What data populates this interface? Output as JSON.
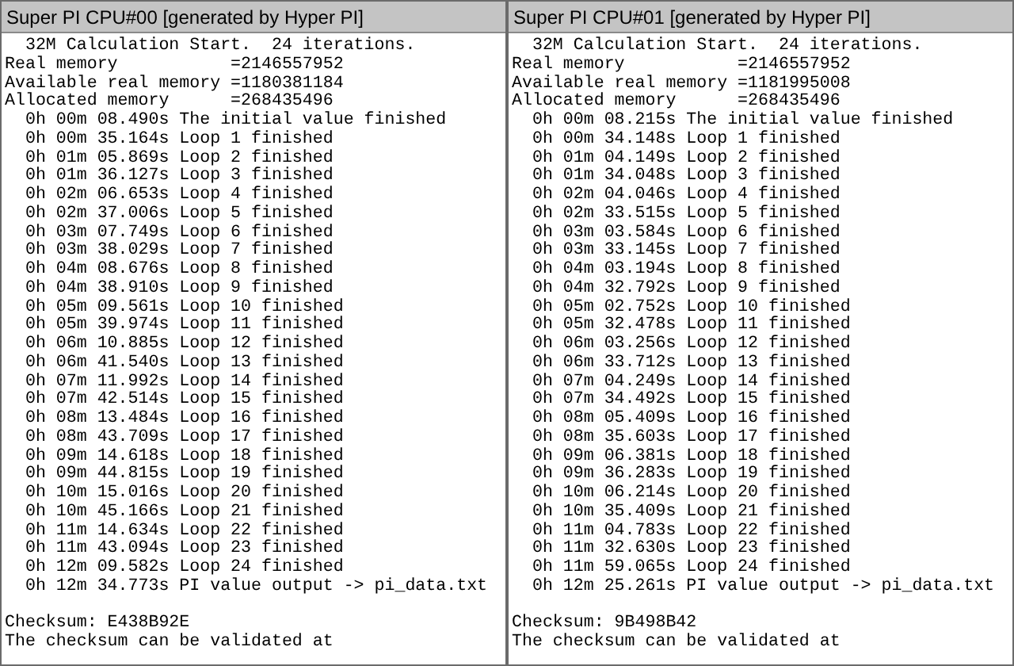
{
  "windows": [
    {
      "title": "Super PI CPU#00 [generated by Hyper PI]",
      "lines": [
        "  32M Calculation Start.  24 iterations.",
        "Real memory           =2146557952",
        "Available real memory =1180381184",
        "Allocated memory      =268435496",
        "  0h 00m 08.490s The initial value finished",
        "  0h 00m 35.164s Loop 1 finished",
        "  0h 01m 05.869s Loop 2 finished",
        "  0h 01m 36.127s Loop 3 finished",
        "  0h 02m 06.653s Loop 4 finished",
        "  0h 02m 37.006s Loop 5 finished",
        "  0h 03m 07.749s Loop 6 finished",
        "  0h 03m 38.029s Loop 7 finished",
        "  0h 04m 08.676s Loop 8 finished",
        "  0h 04m 38.910s Loop 9 finished",
        "  0h 05m 09.561s Loop 10 finished",
        "  0h 05m 39.974s Loop 11 finished",
        "  0h 06m 10.885s Loop 12 finished",
        "  0h 06m 41.540s Loop 13 finished",
        "  0h 07m 11.992s Loop 14 finished",
        "  0h 07m 42.514s Loop 15 finished",
        "  0h 08m 13.484s Loop 16 finished",
        "  0h 08m 43.709s Loop 17 finished",
        "  0h 09m 14.618s Loop 18 finished",
        "  0h 09m 44.815s Loop 19 finished",
        "  0h 10m 15.016s Loop 20 finished",
        "  0h 10m 45.166s Loop 21 finished",
        "  0h 11m 14.634s Loop 22 finished",
        "  0h 11m 43.094s Loop 23 finished",
        "  0h 12m 09.582s Loop 24 finished",
        "  0h 12m 34.773s PI value output -> pi_data.txt"
      ],
      "footer_lines": [
        "Checksum: E438B92E",
        "The checksum can be validated at"
      ]
    },
    {
      "title": "Super PI CPU#01 [generated by Hyper PI]",
      "lines": [
        "  32M Calculation Start.  24 iterations.",
        "Real memory           =2146557952",
        "Available real memory =1181995008",
        "Allocated memory      =268435496",
        "  0h 00m 08.215s The initial value finished",
        "  0h 00m 34.148s Loop 1 finished",
        "  0h 01m 04.149s Loop 2 finished",
        "  0h 01m 34.048s Loop 3 finished",
        "  0h 02m 04.046s Loop 4 finished",
        "  0h 02m 33.515s Loop 5 finished",
        "  0h 03m 03.584s Loop 6 finished",
        "  0h 03m 33.145s Loop 7 finished",
        "  0h 04m 03.194s Loop 8 finished",
        "  0h 04m 32.792s Loop 9 finished",
        "  0h 05m 02.752s Loop 10 finished",
        "  0h 05m 32.478s Loop 11 finished",
        "  0h 06m 03.256s Loop 12 finished",
        "  0h 06m 33.712s Loop 13 finished",
        "  0h 07m 04.249s Loop 14 finished",
        "  0h 07m 34.492s Loop 15 finished",
        "  0h 08m 05.409s Loop 16 finished",
        "  0h 08m 35.603s Loop 17 finished",
        "  0h 09m 06.381s Loop 18 finished",
        "  0h 09m 36.283s Loop 19 finished",
        "  0h 10m 06.214s Loop 20 finished",
        "  0h 10m 35.409s Loop 21 finished",
        "  0h 11m 04.783s Loop 22 finished",
        "  0h 11m 32.630s Loop 23 finished",
        "  0h 11m 59.065s Loop 24 finished",
        "  0h 12m 25.261s PI value output -> pi_data.txt"
      ],
      "footer_lines": [
        "Checksum: 9B498B42",
        "The checksum can be validated at"
      ]
    }
  ]
}
